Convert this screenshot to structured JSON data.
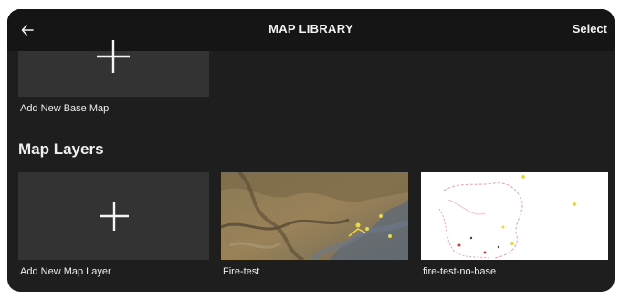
{
  "header": {
    "title": "MAP LIBRARY",
    "select_label": "Select",
    "back_icon": "back-arrow-icon"
  },
  "base_maps": {
    "add_label": "Add New Base Map"
  },
  "map_layers": {
    "section_title": "Map Layers",
    "add_label": "Add New Map Layer",
    "items": [
      {
        "label": "Fire-test"
      },
      {
        "label": "fire-test-no-base"
      }
    ]
  },
  "colors": {
    "background": "#1e1e1e",
    "tile": "#333333",
    "text": "#f2f2f2"
  }
}
